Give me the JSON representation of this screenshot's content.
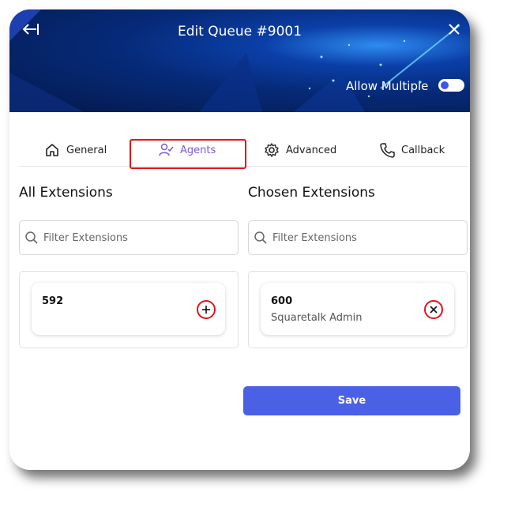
{
  "header": {
    "title": "Edit Queue #9001",
    "allow_multiple_label": "Allow Multiple",
    "allow_multiple_on": true
  },
  "tabs": [
    {
      "label": "General",
      "icon": "home-icon"
    },
    {
      "label": "Agents",
      "icon": "user-check-icon",
      "active": true
    },
    {
      "label": "Advanced",
      "icon": "gear-icon"
    },
    {
      "label": "Callback",
      "icon": "phone-icon"
    }
  ],
  "all_extensions": {
    "title": "All Extensions",
    "search_placeholder": "Filter Extensions",
    "items": [
      {
        "extension": "592",
        "name": ""
      }
    ]
  },
  "chosen_extensions": {
    "title": "Chosen Extensions",
    "search_placeholder": "Filter Extensions",
    "items": [
      {
        "extension": "600",
        "name": "Squaretalk Admin"
      }
    ]
  },
  "save_label": "Save",
  "colors": {
    "accent": "#4a61e6",
    "active_tab": "#7b5bd6",
    "highlight": "#e0151a"
  }
}
